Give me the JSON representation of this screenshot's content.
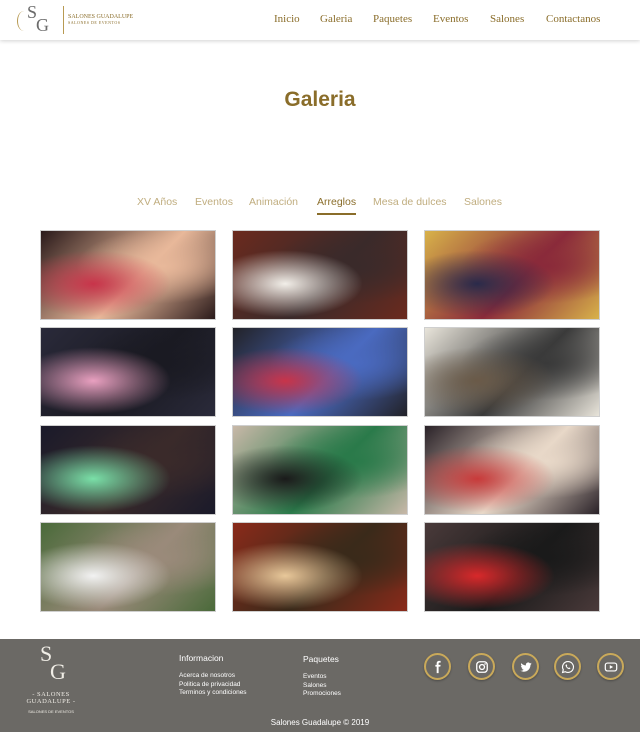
{
  "header": {
    "logo_initials_s": "S",
    "logo_initials_g": "G",
    "logo_name": "SALONES GUADALUPE",
    "logo_sub": "SALONES DE EVENTOS",
    "nav": [
      "Inicio",
      "Galeria",
      "Paquetes",
      "Eventos",
      "Salones",
      "Contactanos"
    ]
  },
  "page_title": "Galeria",
  "tabs": {
    "items": [
      "XV Años",
      "Eventos",
      "Animación",
      "Arreglos",
      "Mesa de dulces",
      "Salones"
    ],
    "active": "Arreglos"
  },
  "gallery": {
    "photos": [
      {
        "name": "photo-friends-singing",
        "palette": [
          "#2a1a1a",
          "#c8344a",
          "#e8b89a"
        ]
      },
      {
        "name": "photo-couple-doorway",
        "palette": [
          "#6b2a1e",
          "#f2efe9",
          "#3a2a2a"
        ]
      },
      {
        "name": "photo-group-yellow-building",
        "palette": [
          "#d8b24a",
          "#2a2a4a",
          "#8a2a3a"
        ]
      },
      {
        "name": "photo-quinceanera-chambelanes",
        "palette": [
          "#2a2a3a",
          "#e9a0c0",
          "#1a1a22"
        ]
      },
      {
        "name": "photo-dance-show",
        "palette": [
          "#222228",
          "#c8344a",
          "#4a6ac0"
        ]
      },
      {
        "name": "photo-balcony-building",
        "palette": [
          "#e8e4da",
          "#6a5a48",
          "#3a3a3a"
        ]
      },
      {
        "name": "photo-lantern-release",
        "palette": [
          "#1a1a2a",
          "#7ae0a8",
          "#3a2a2a"
        ]
      },
      {
        "name": "photo-girls-sofa",
        "palette": [
          "#c8b8a8",
          "#1a1a1a",
          "#2a7a4a"
        ]
      },
      {
        "name": "photo-party-balloons",
        "palette": [
          "#2a2228",
          "#c83a3a",
          "#e8d8c8"
        ]
      },
      {
        "name": "photo-bride-garden",
        "palette": [
          "#4a6a3a",
          "#f2f2f2",
          "#9a8a7a"
        ]
      },
      {
        "name": "photo-ballroom",
        "palette": [
          "#8a2a1a",
          "#e8c89a",
          "#3a2a1a"
        ]
      },
      {
        "name": "photo-red-dress-portrait",
        "palette": [
          "#4a3a3a",
          "#d8282a",
          "#1a1a1a"
        ]
      }
    ]
  },
  "footer": {
    "logo_s": "S",
    "logo_g": "G",
    "logo_name": "- SALONES GUADALUPE -",
    "logo_sub": "SALONES DE EVENTOS",
    "info_title": "Informacion",
    "info_links": [
      "Acerca de nosotros",
      "Politica de privacidad",
      "Terminos y condiciones"
    ],
    "paq_title": "Paquetes",
    "paq_links": [
      "Eventos",
      "Salones",
      "Promociones"
    ],
    "social": [
      "facebook-icon",
      "instagram-icon",
      "twitter-icon",
      "whatsapp-icon",
      "youtube-icon"
    ],
    "copyright": "Salones Guadalupe © 2019",
    "accent": "#c9a95a",
    "background": "#6b6965"
  },
  "colors": {
    "brand_gold": "#8a6d2a",
    "tab_inactive": "#c0ad7f"
  }
}
